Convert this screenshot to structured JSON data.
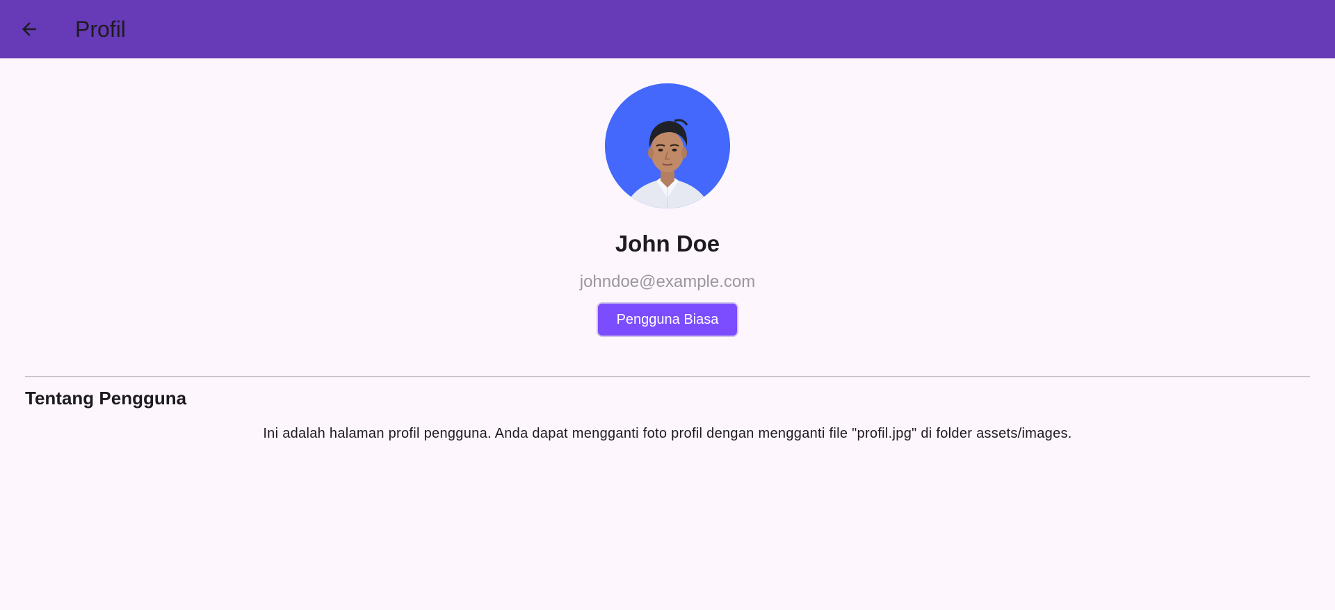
{
  "app_bar": {
    "title": "Profil",
    "back_icon": "arrow-back-icon",
    "background_color": "#673ab7"
  },
  "profile": {
    "avatar_icon": "profile-photo",
    "avatar_background": "#4368fb",
    "name": "John Doe",
    "email": "johndoe@example.com",
    "role_label": "Pengguna Biasa",
    "role_color": "#7c4dff"
  },
  "about": {
    "title": "Tentang Pengguna",
    "text": "Ini adalah halaman profil pengguna. Anda dapat mengganti foto profil dengan mengganti file \"profil.jpg\" di folder assets/images."
  }
}
